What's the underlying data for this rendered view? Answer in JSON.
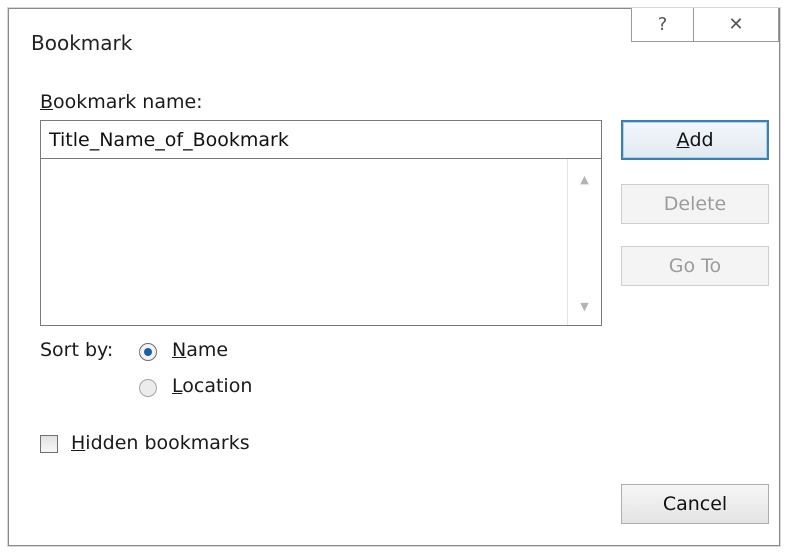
{
  "window": {
    "title": "Bookmark",
    "help_glyph": "?",
    "close_glyph": "✕"
  },
  "form": {
    "name_label_mnemonic": "B",
    "name_label_rest": "ookmark name:",
    "name_value": "Title_Name_of_Bookmark",
    "bookmarks": [],
    "scroll_up_glyph": "▲",
    "scroll_down_glyph": "▼"
  },
  "sort": {
    "label": "Sort by:",
    "selected": "Name",
    "options": [
      {
        "mnemonic": "N",
        "rest": "ame"
      },
      {
        "mnemonic": "L",
        "rest": "ocation"
      }
    ]
  },
  "hidden": {
    "mnemonic": "H",
    "rest": "idden bookmarks",
    "checked": false
  },
  "buttons": {
    "add_mnemonic": "A",
    "add_rest": "dd",
    "delete": "Delete",
    "goto": "Go To",
    "cancel": "Cancel"
  },
  "icons": {
    "help": "help-icon",
    "close": "close-icon"
  },
  "colors": {
    "default_button_border": "#3c7fb1",
    "radio_fill": "#1c5fa5",
    "disabled_text": "#9c9c9c"
  }
}
